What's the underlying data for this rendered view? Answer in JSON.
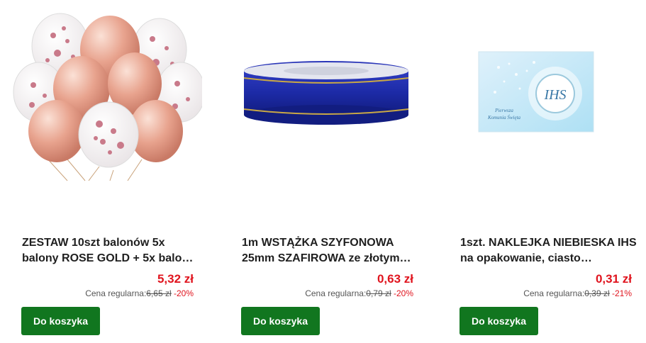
{
  "products": [
    {
      "title": "ZESTAW 10szt balonów 5x balony ROSE GOLD + 5x balo…",
      "price": "5,32 zł",
      "regular_label": "Cena regularna:",
      "old_price": "6,65 zł",
      "discount": "-20%",
      "button": "Do koszyka"
    },
    {
      "title": "1m WSTĄŻKA SZYFONOWA 25mm SZAFIROWA ze złotym…",
      "price": "0,63 zł",
      "regular_label": "Cena regularna:",
      "old_price": "0,79 zł",
      "discount": "-20%",
      "button": "Do koszyka"
    },
    {
      "title": "1szt. NAKLEJKA NIEBIESKA IHS na opakowanie, ciasto…",
      "price": "0,31 zł",
      "regular_label": "Cena regularna:",
      "old_price": "0,39 zł",
      "discount": "-21%",
      "button": "Do koszyka"
    }
  ],
  "sticker": {
    "logo": "IHS",
    "caption_1": "Pierwsza",
    "caption_2": "Komunia Święta"
  },
  "colors": {
    "price": "#e0141e",
    "button": "#11761f",
    "ribbon": "#1f2fae",
    "rose_gold": "#e6a48e"
  }
}
